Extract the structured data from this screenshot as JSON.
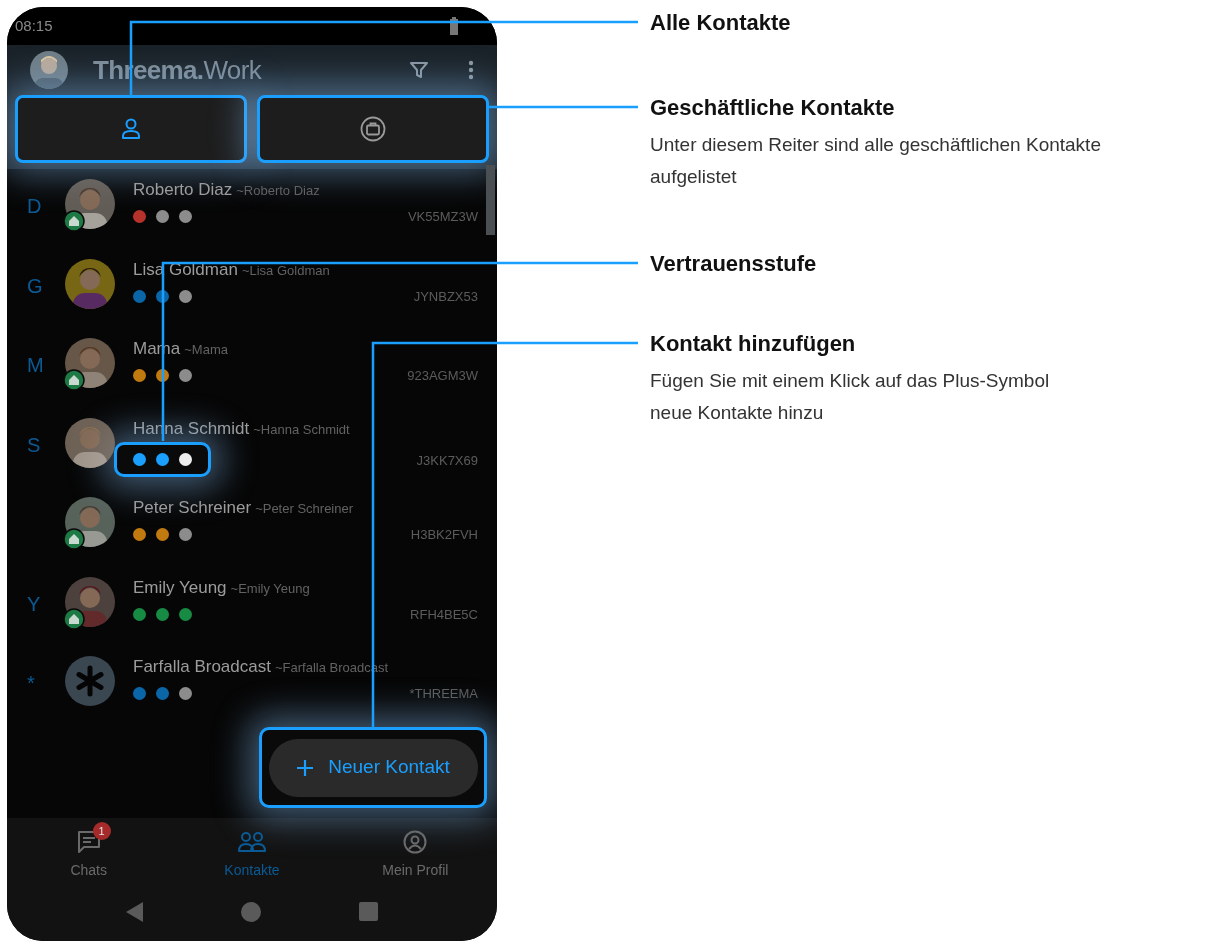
{
  "status_bar": {
    "time": "08:15"
  },
  "header": {
    "title": "**Threema.**Work"
  },
  "tabs": [
    {
      "selected": true,
      "highlighted": true
    },
    {
      "selected": false,
      "highlighted": true
    }
  ],
  "contacts": [
    {
      "letter": "D",
      "name": "Roberto Diaz",
      "nickname": "~Roberto Diaz",
      "id": "VK55MZ3W",
      "work": true,
      "trust_highlighted": false,
      "trust": [
        {
          "color": "#b8322c"
        },
        {
          "color": "#8c8c8c"
        },
        {
          "color": "#8c8c8c"
        }
      ]
    },
    {
      "letter": "G",
      "name": "Lisa Goldman",
      "nickname": "~Lisa Goldman",
      "id": "JYNBZX53",
      "work": false,
      "trust_highlighted": false,
      "trust": [
        {
          "color": "#0b66a8"
        },
        {
          "color": "#0b66a8"
        },
        {
          "color": "#8c8c8c"
        }
      ]
    },
    {
      "letter": "M",
      "name": "Mama",
      "nickname": "~Mama",
      "id": "923AGM3W",
      "work": true,
      "trust_highlighted": false,
      "trust": [
        {
          "color": "#c07a10"
        },
        {
          "color": "#c07a10"
        },
        {
          "color": "#8c8c8c"
        }
      ]
    },
    {
      "letter": "S",
      "name": "Hanna Schmidt",
      "nickname": "~Hanna Schmidt",
      "id": "J3KK7X69",
      "work": false,
      "trust_highlighted": true,
      "trust": [
        {
          "color": "#1a9fff"
        },
        {
          "color": "#1a9fff"
        },
        {
          "color": "#eeeeee"
        }
      ]
    },
    {
      "name": "Peter Schreiner",
      "nickname": "~Peter Schreiner",
      "id": "H3BK2FVH",
      "work": true,
      "trust_highlighted": false,
      "trust": [
        {
          "color": "#c07a10"
        },
        {
          "color": "#c07a10"
        },
        {
          "color": "#8c8c8c"
        }
      ]
    },
    {
      "letter": "Y",
      "name": "Emily Yeung",
      "nickname": "~Emily Yeung",
      "id": "RFH4BE5C",
      "work": true,
      "trust_highlighted": false,
      "trust": [
        {
          "color": "#178a44"
        },
        {
          "color": "#178a44"
        },
        {
          "color": "#178a44"
        }
      ]
    },
    {
      "letter": "*",
      "name": "Farfalla Broadcast",
      "nickname": "~Farfalla Broadcast",
      "id": "*THREEMA",
      "kind": "broadcast",
      "work": false,
      "trust_highlighted": false,
      "trust": [
        {
          "color": "#0b66a8"
        },
        {
          "color": "#0b66a8"
        },
        {
          "color": "#8c8c8c"
        }
      ]
    }
  ],
  "fab": {
    "label": "Neuer Kontakt",
    "highlighted": true
  },
  "bottom_nav": [
    {
      "label": "Chats",
      "selected": false,
      "badge": "1"
    },
    {
      "label": "Kontakte",
      "selected": true
    },
    {
      "label": "Mein Profil",
      "selected": false
    }
  ],
  "callouts": [
    {
      "title": "Alle Kontakte"
    },
    {
      "title": "Geschäftliche Kontakte",
      "description": "Unter diesem Reiter sind alle geschäftlichen Kontakte aufgelistet"
    },
    {
      "title": "Vertrauensstufe"
    },
    {
      "title": "Kontakt hinzufügen",
      "description": "Fügen Sie mit einem Klick auf das Plus-Symbol neue Kontakte hinzu"
    }
  ]
}
